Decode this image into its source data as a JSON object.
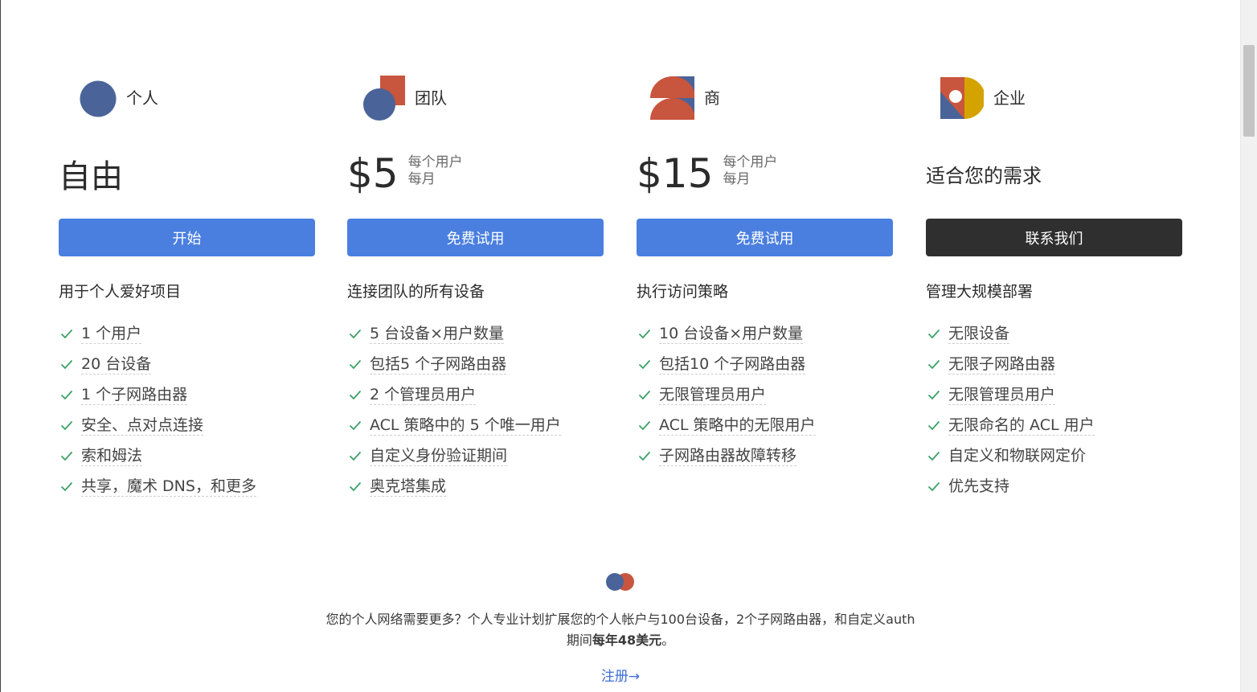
{
  "plans": [
    {
      "name": "个人",
      "price_text": "自由",
      "button_label": "开始",
      "description": "用于个人爱好项目",
      "features": [
        "1 个用户",
        "20 台设备",
        "1 个子网路由器",
        "安全、点对点连接",
        "索和姆法",
        "共享，魔术 DNS，和更多"
      ]
    },
    {
      "name": "团队",
      "price_amount": "$5",
      "price_note_line1": "每个用户",
      "price_note_line2": "每月",
      "button_label": "免费试用",
      "description": "连接团队的所有设备",
      "features": [
        "5 台设备×用户数量",
        "包括5 个子网路由器",
        "2 个管理员用户",
        "ACL 策略中的 5 个唯一用户",
        "自定义身份验证期间",
        "奥克塔集成"
      ]
    },
    {
      "name": "商",
      "price_amount": "$15",
      "price_note_line1": "每个用户",
      "price_note_line2": "每月",
      "button_label": "免费试用",
      "description": "执行访问策略",
      "features": [
        "10 台设备×用户数量",
        "包括10 个子网路由器",
        "无限管理员用户",
        "ACL 策略中的无限用户",
        "子网路由器故障转移"
      ]
    },
    {
      "name": "企业",
      "price_text": "适合您的需求",
      "button_label": "联系我们",
      "description": "管理大规模部署",
      "features": [
        "无限设备",
        "无限子网路由器",
        "无限管理员用户",
        "无限命名的 ACL 用户",
        "自定义和物联网定价",
        "优先支持"
      ]
    }
  ],
  "pro": {
    "description_part1": "您的个人网络需要更多？个人专业计划扩展您的个人帐户与100台设备，2个子网路由器，和自定义auth期间",
    "description_bold": "每年48美元",
    "description_end": "。",
    "link_label": "注册→"
  },
  "colors": {
    "primary_button": "#4a7fdf",
    "dark_button": "#2f2f2f",
    "logo_blue": "#4a6499",
    "logo_orange": "#c8553d",
    "logo_yellow": "#d4a300",
    "check_green": "#3aa166",
    "link_blue": "#3d6ed8"
  },
  "icons": [
    "check-icon",
    "personal-plan-logo",
    "team-plan-logo",
    "business-plan-logo",
    "enterprise-plan-logo",
    "personal-pro-logo"
  ]
}
